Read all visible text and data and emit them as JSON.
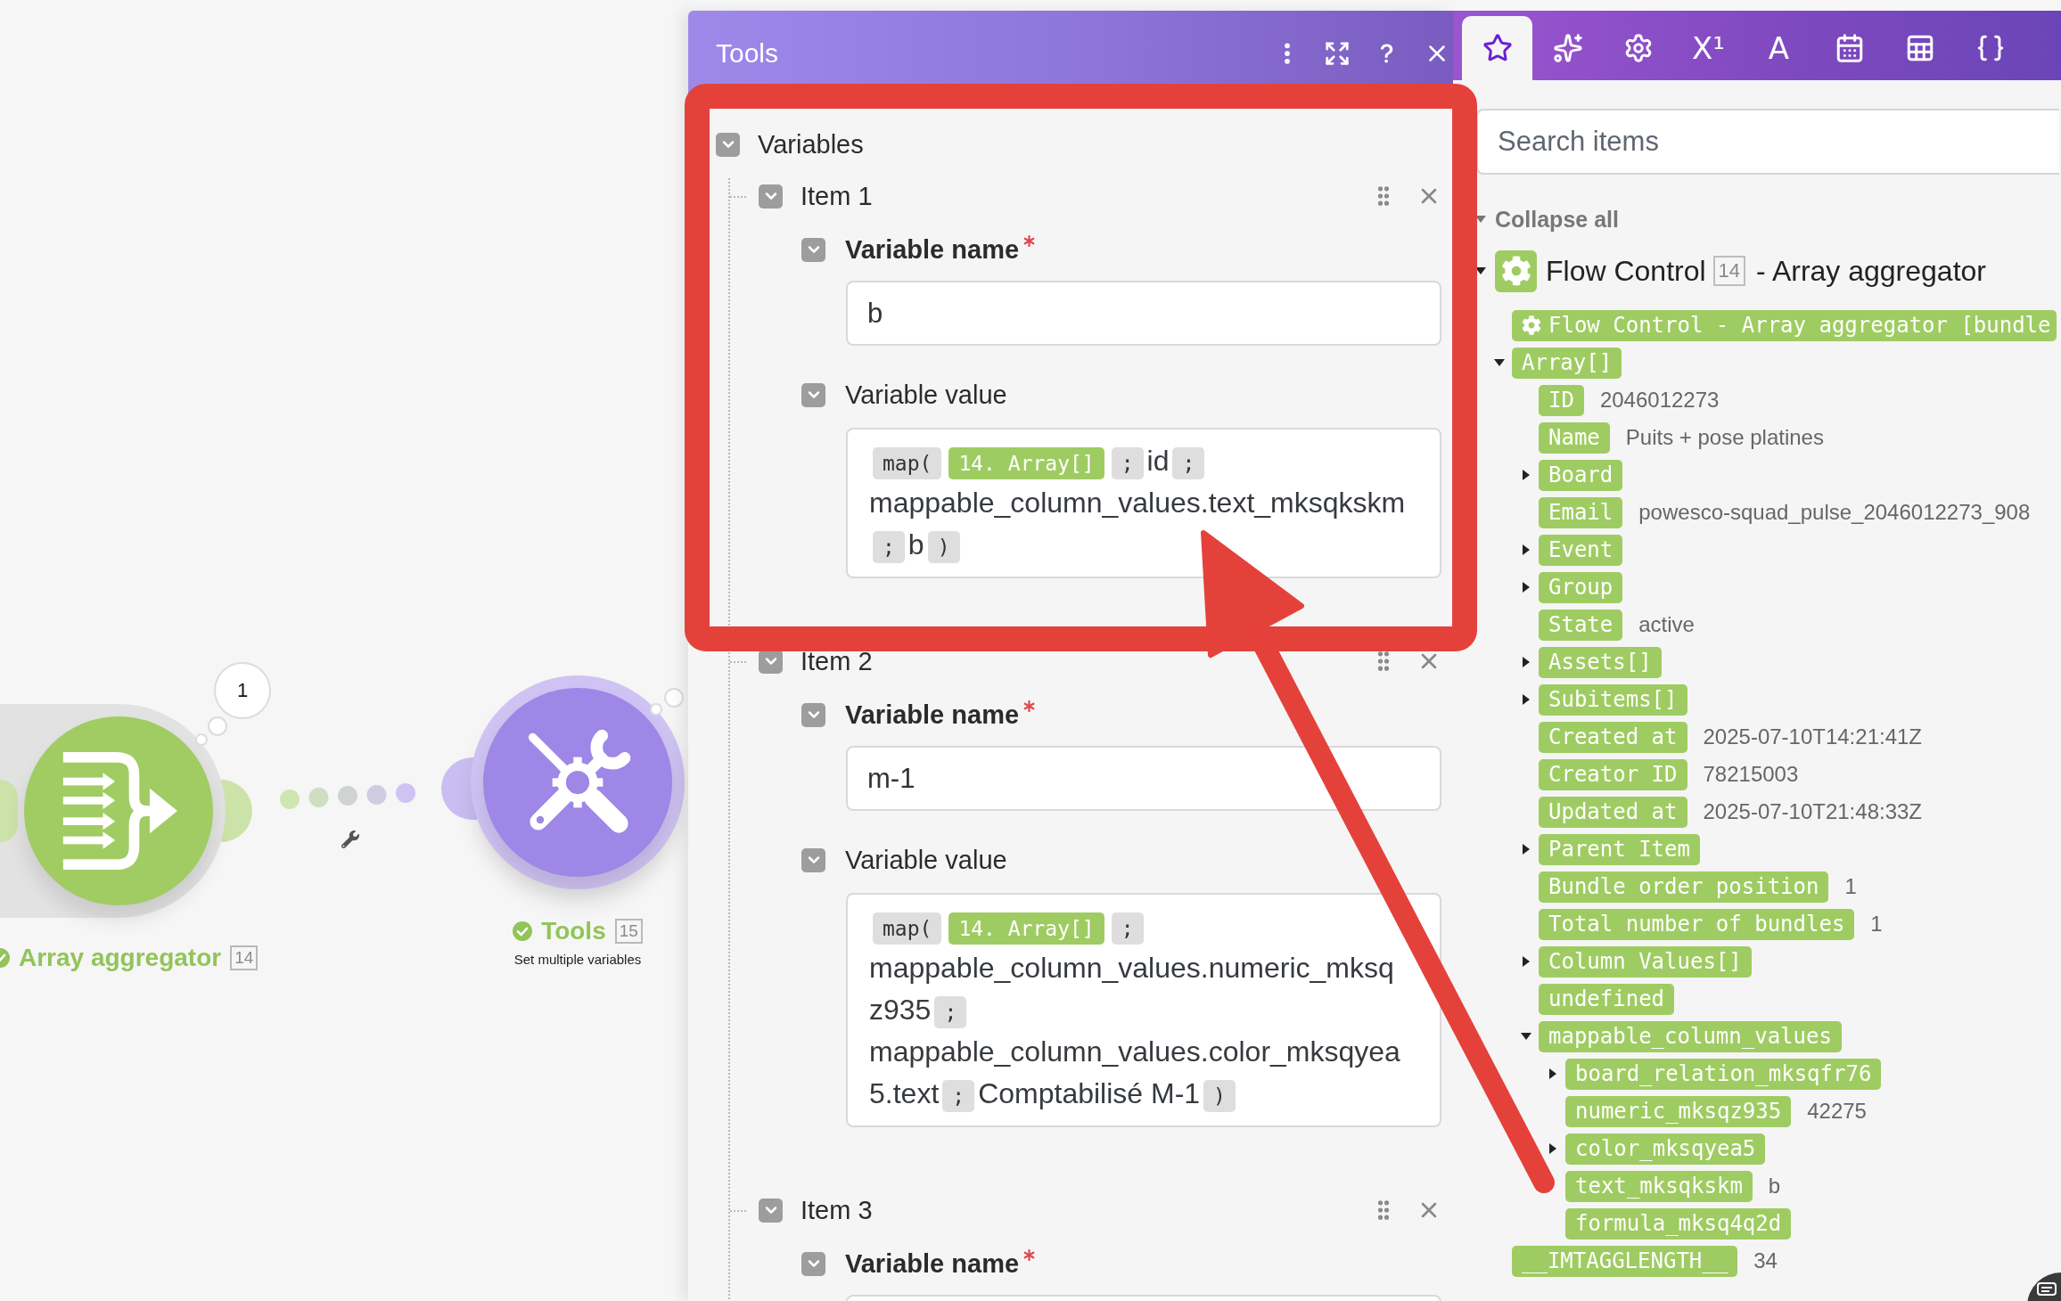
{
  "canvas": {
    "modules": [
      {
        "kind": "aggregator",
        "name": "Array aggregator",
        "number": "14",
        "succeeded": true,
        "color": "#a0cc63",
        "run_count": "1"
      },
      {
        "kind": "tools",
        "name": "Tools",
        "number": "15",
        "description": "Set multiple variables",
        "succeeded": true,
        "color": "#9e87e6"
      }
    ]
  },
  "tools_panel": {
    "title": "Tools",
    "variables": {
      "label": "Variables",
      "expanded": true,
      "items": [
        {
          "label": "Item 1",
          "expanded": true,
          "fields": [
            {
              "kind": "text",
              "label": "Variable name",
              "required": true,
              "expanded": true,
              "value": "b"
            },
            {
              "kind": "formula",
              "label": "Variable value",
              "required": false,
              "expanded": true,
              "tokens": [
                {
                  "kind": "function",
                  "text": "map("
                },
                {
                  "kind": "item",
                  "text": "14. Array[]"
                },
                {
                  "kind": "separator",
                  "text": ";"
                },
                {
                  "kind": "text",
                  "text": "id"
                },
                {
                  "kind": "separator",
                  "text": ";"
                },
                {
                  "kind": "text",
                  "text": "mappable_column_values.text_mksqkskm"
                },
                {
                  "kind": "separator",
                  "text": ";"
                },
                {
                  "kind": "text",
                  "text": "b"
                },
                {
                  "kind": "separator",
                  "text": ")"
                }
              ]
            }
          ]
        },
        {
          "label": "Item 2",
          "expanded": true,
          "fields": [
            {
              "kind": "text",
              "label": "Variable name",
              "required": true,
              "expanded": true,
              "value": "m-1"
            },
            {
              "kind": "formula",
              "label": "Variable value",
              "required": false,
              "expanded": true,
              "tokens": [
                {
                  "kind": "function",
                  "text": "map("
                },
                {
                  "kind": "item",
                  "text": "14. Array[]"
                },
                {
                  "kind": "separator",
                  "text": ";"
                },
                {
                  "kind": "text",
                  "text": "mappable_column_values.numeric_mksqz935"
                },
                {
                  "kind": "separator",
                  "text": ";"
                },
                {
                  "kind": "text",
                  "text": "mappable_column_values.color_mksqyea5.text"
                },
                {
                  "kind": "separator",
                  "text": ";"
                },
                {
                  "kind": "text",
                  "text": "Comptabilisé M-1"
                },
                {
                  "kind": "separator",
                  "text": ")"
                }
              ]
            }
          ]
        },
        {
          "label": "Item 3",
          "expanded": true,
          "fields": [
            {
              "kind": "text",
              "label": "Variable name",
              "required": true,
              "expanded": true
            }
          ]
        }
      ]
    }
  },
  "data_panel": {
    "tabs": [
      {
        "selected": true
      },
      {
        "selected": false
      },
      {
        "selected": false
      },
      {
        "label": "X¹",
        "selected": false
      },
      {
        "label": "A",
        "selected": false
      },
      {
        "selected": false
      },
      {
        "selected": false
      },
      {
        "selected": false
      }
    ],
    "search": {
      "placeholder": "Search items"
    },
    "collapse_all": "Collapse all",
    "modules": [
      {
        "app": "Flow Control",
        "number": "14",
        "title": "- Array aggregator",
        "expanded": true,
        "items": [
          {
            "kind": "bundle",
            "label": "Flow Control - Array aggregator [bundle"
          },
          {
            "kind": "collection",
            "label": "Array[]",
            "expanded": true,
            "children": [
              {
                "kind": "field",
                "label": "ID",
                "value": "2046012273"
              },
              {
                "kind": "field",
                "label": "Name",
                "value": "Puits + pose platines"
              },
              {
                "kind": "collection",
                "label": "Board",
                "expanded": false
              },
              {
                "kind": "field",
                "label": "Email",
                "value": "powesco-squad_pulse_2046012273_908"
              },
              {
                "kind": "collection",
                "label": "Event",
                "expanded": false
              },
              {
                "kind": "collection",
                "label": "Group",
                "expanded": false
              },
              {
                "kind": "field",
                "label": "State",
                "value": "active"
              },
              {
                "kind": "collection",
                "label": "Assets[]",
                "expanded": false
              },
              {
                "kind": "collection",
                "label": "Subitems[]",
                "expanded": false
              },
              {
                "kind": "field",
                "label": "Created at",
                "value": "2025-07-10T14:21:41Z"
              },
              {
                "kind": "field",
                "label": "Creator ID",
                "value": "78215003"
              },
              {
                "kind": "field",
                "label": "Updated at",
                "value": "2025-07-10T21:48:33Z"
              },
              {
                "kind": "collection",
                "label": "Parent Item",
                "expanded": false
              },
              {
                "kind": "field",
                "label": "Bundle order position",
                "value": "1"
              },
              {
                "kind": "field",
                "label": "Total number of bundles",
                "value": "1"
              },
              {
                "kind": "collection",
                "label": "Column Values[]",
                "expanded": false
              },
              {
                "kind": "field",
                "label": "undefined"
              },
              {
                "kind": "collection",
                "label": "mappable_column_values",
                "expanded": true,
                "children": [
                  {
                    "kind": "collection",
                    "label": "board_relation_mksqfr76",
                    "expanded": false
                  },
                  {
                    "kind": "field",
                    "label": "numeric_mksqz935",
                    "value": "42275"
                  },
                  {
                    "kind": "collection",
                    "label": "color_mksqyea5",
                    "expanded": false
                  },
                  {
                    "kind": "field",
                    "label": "text_mksqkskm",
                    "value": "b"
                  },
                  {
                    "kind": "field",
                    "label": "formula_mksq4q2d"
                  }
                ]
              }
            ]
          },
          {
            "kind": "field",
            "label": "__IMTAGGLENGTH__",
            "value": "34"
          }
        ]
      }
    ]
  },
  "markup": {
    "frame": true,
    "arrow": true
  }
}
